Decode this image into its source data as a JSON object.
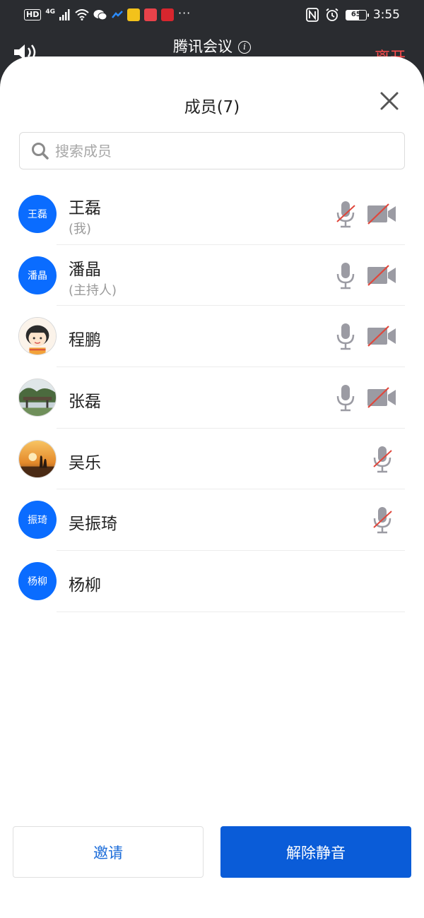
{
  "status_bar": {
    "hd": "HD",
    "network": "4G",
    "battery": "65",
    "time": "3:55",
    "more": "···"
  },
  "meeting": {
    "title": "腾讯会议",
    "info_glyph": "i",
    "leave_label": "离开"
  },
  "panel": {
    "title": "成员(7)",
    "search_placeholder": "搜索成员"
  },
  "members": [
    {
      "name": "王磊",
      "role": "(我)",
      "avatar_text": "王磊",
      "mic": "muted",
      "camera": "off"
    },
    {
      "name": "潘晶",
      "role": "(主持人)",
      "avatar_text": "潘晶",
      "mic": "on",
      "camera": "off"
    },
    {
      "name": "程鹏",
      "avatar_text": "",
      "mic": "on",
      "camera": "off"
    },
    {
      "name": "张磊",
      "avatar_text": "",
      "mic": "on",
      "camera": "off"
    },
    {
      "name": "吴乐",
      "avatar_text": "",
      "mic": "muted"
    },
    {
      "name": "吴振琦",
      "avatar_text": "振琦",
      "mic": "muted"
    },
    {
      "name": "杨柳",
      "avatar_text": "杨柳"
    }
  ],
  "actions": {
    "invite_label": "邀请",
    "unmute_label": "解除静音"
  },
  "colors": {
    "accent": "#0a5cd8",
    "avatar_blue": "#0a6cff",
    "leave_red": "#ff4d4d",
    "muted_slash": "#e0473c"
  }
}
